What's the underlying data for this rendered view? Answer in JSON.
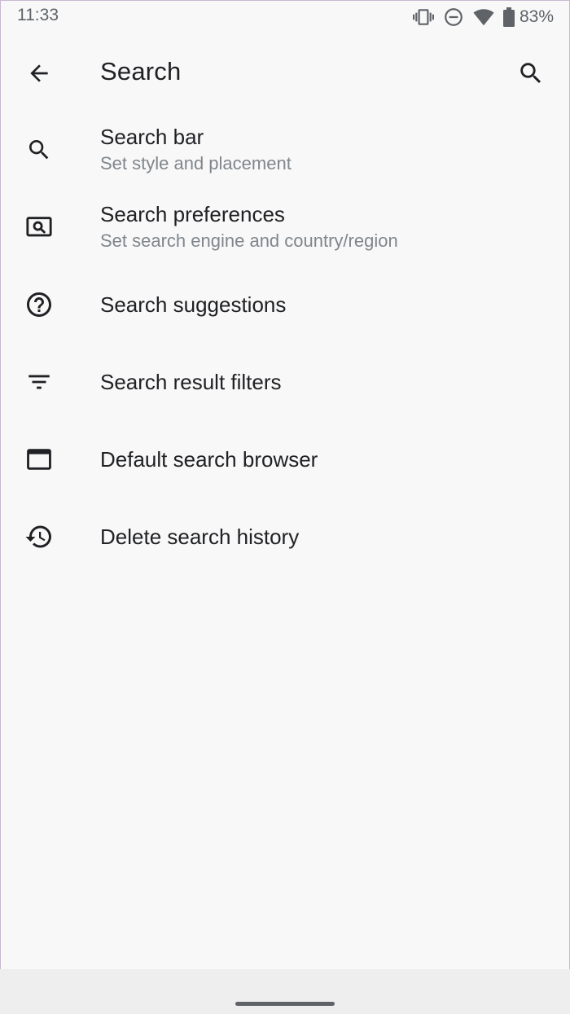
{
  "status_bar": {
    "time": "11:33",
    "battery_percent": "83%",
    "icons": [
      "vibrate-icon",
      "do-not-disturb-icon",
      "wifi-icon",
      "battery-icon"
    ]
  },
  "app_bar": {
    "title": "Search",
    "back_icon": "arrow-back-icon",
    "search_icon": "search-icon"
  },
  "list": {
    "items": [
      {
        "title": "Search bar",
        "subtitle": "Set style and placement",
        "icon": "search-icon"
      },
      {
        "title": "Search preferences",
        "subtitle": "Set search engine and country/region",
        "icon": "screen-search-icon"
      },
      {
        "title": "Search suggestions",
        "icon": "help-circle-icon"
      },
      {
        "title": "Search result filters",
        "icon": "filter-icon"
      },
      {
        "title": "Default search browser",
        "icon": "browser-window-icon"
      },
      {
        "title": "Delete search history",
        "icon": "history-icon"
      }
    ]
  },
  "colors": {
    "background": "#f8f8f8",
    "primary_text": "#202124",
    "secondary_text": "#80868b",
    "icon": "#202124"
  }
}
